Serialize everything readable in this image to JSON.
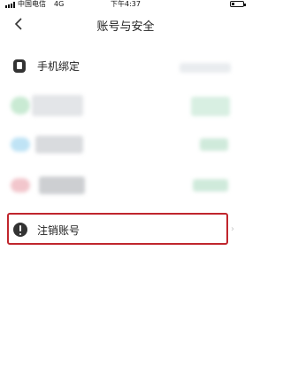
{
  "status_bar": {
    "carrier": "中国电信",
    "network": "4G",
    "time": "下午4:37"
  },
  "nav": {
    "title": "账号与安全",
    "back_icon": "chevron-left-icon"
  },
  "items": {
    "phone_binding": {
      "label": "手机绑定",
      "icon": "phone-icon"
    },
    "cancel_account": {
      "label": "注销账号",
      "icon": "warning-circle-icon",
      "chevron_icon": "chevron-right-icon"
    }
  },
  "colors": {
    "highlight_border": "#c0262d",
    "icon_dark": "#333333"
  }
}
